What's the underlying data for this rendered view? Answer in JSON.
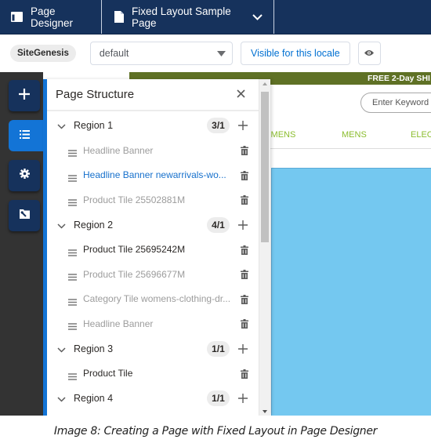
{
  "header": {
    "app_title": "Page Designer",
    "page_title": "Fixed Layout Sample Page",
    "app_icon": "layout-icon",
    "page_icon": "document-icon",
    "dropdown_icon": "chevron-down-icon"
  },
  "toolbar": {
    "site_badge": "SiteGenesis",
    "locale_value": "default",
    "visibility_button": "Visible for this locale",
    "preview_icon": "eye-icon"
  },
  "rail": {
    "items": [
      {
        "name": "add-components",
        "icon": "plus-icon",
        "active": false
      },
      {
        "name": "page-structure",
        "icon": "list-icon",
        "active": true
      },
      {
        "name": "page-settings",
        "icon": "gear-icon",
        "active": false
      },
      {
        "name": "page-properties",
        "icon": "folder-wrench-icon",
        "active": false
      }
    ]
  },
  "panel": {
    "title": "Page Structure",
    "close_icon": "close-icon",
    "regions": [
      {
        "label": "Region 1",
        "count": "3/1",
        "items": [
          {
            "label": "Headline Banner",
            "state": "inactive"
          },
          {
            "label": "Headline Banner newarrivals-wo...",
            "state": "selected"
          },
          {
            "label": "Product Tile 25502881M",
            "state": "inactive"
          }
        ]
      },
      {
        "label": "Region 2",
        "count": "4/1",
        "items": [
          {
            "label": "Product Tile 25695242M",
            "state": "visible"
          },
          {
            "label": "Product Tile 25696677M",
            "state": "inactive"
          },
          {
            "label": "Category Tile womens-clothing-dr...",
            "state": "inactive"
          },
          {
            "label": "Headline Banner",
            "state": "inactive"
          }
        ]
      },
      {
        "label": "Region 3",
        "count": "1/1",
        "items": [
          {
            "label": "Product Tile",
            "state": "visible"
          }
        ]
      },
      {
        "label": "Region 4",
        "count": "1/1",
        "items": []
      }
    ]
  },
  "preview": {
    "promo_text": "FREE 2-Day SHI",
    "search_placeholder": "Enter Keyword o",
    "nav_items": [
      "OMENS",
      "MENS",
      "ELEC"
    ]
  },
  "colors": {
    "header_bg": "#16325c",
    "accent_blue": "#1374d6",
    "link_blue": "#0070d2",
    "promo_green": "#5f7125",
    "nav_green": "#8bbd2e",
    "hero_blue": "#74c8f0",
    "rail_bg": "#333333"
  },
  "caption": "Image 8: Creating a Page with Fixed Layout in Page Designer"
}
